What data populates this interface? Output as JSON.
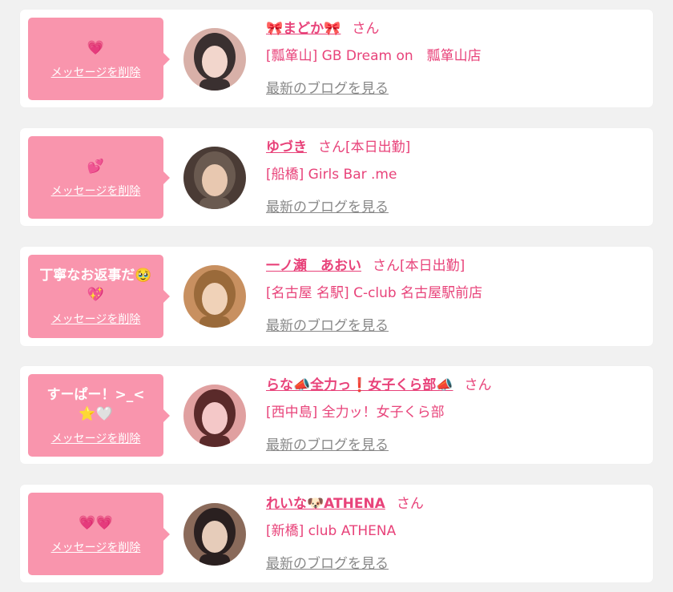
{
  "delete_label": "メッセージを削除",
  "blog_label": "最新のブログを見る",
  "honorific": "さん",
  "today_label": "[本日出勤]",
  "colors": {
    "bubble": "#f995ad",
    "name": "#e8437a",
    "link_gray": "#888888",
    "card": "#ffffff",
    "background": "#f1f1f1"
  },
  "cards": [
    {
      "message": "💗",
      "name": "🎀まどか🎀",
      "show_today": false,
      "shop": "[瓢箪山] GB Dream on　瓢箪山店"
    },
    {
      "message": "💕",
      "name": "ゆづき",
      "show_today": true,
      "shop": "[船橋] Girls Bar .me"
    },
    {
      "message": "丁寧なお返事だ🥹\n💖",
      "name": "一ノ瀬　あおい",
      "show_today": true,
      "shop": "[名古屋 名駅] C-club 名古屋駅前店"
    },
    {
      "message": "すーぱー！>_<\n⭐🤍",
      "name": "らな📣全力っ❗女子くら部📣",
      "show_today": false,
      "shop": "[西中島] 全力ッ！女子くら部"
    },
    {
      "message": "💗💗",
      "name": "れいな🐶ATHENA",
      "show_today": false,
      "shop": "[新橋] club ATHENA"
    }
  ]
}
